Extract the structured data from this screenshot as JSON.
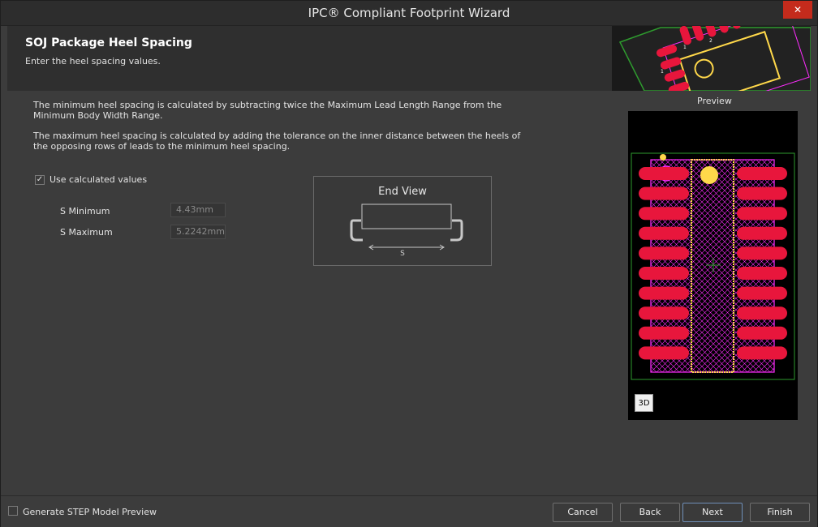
{
  "window": {
    "title": "IPC® Compliant Footprint Wizard",
    "close_label": "✕"
  },
  "header": {
    "title": "SOJ Package Heel Spacing",
    "subtitle": "Enter the heel spacing values.",
    "art_pad_labels": [
      "1",
      "2",
      "1"
    ]
  },
  "body": {
    "paragraph_1": "The minimum heel spacing is calculated by subtracting twice the Maximum Lead Length Range from the Minimum Body Width Range.",
    "paragraph_2": "The maximum heel spacing is calculated by adding the tolerance on the inner distance between the heels of the opposing rows of leads to the minimum heel spacing.",
    "use_calculated": {
      "label": "Use calculated values",
      "checked": true,
      "mark": "✓"
    },
    "s_minimum": {
      "label": "S Minimum",
      "value": "4.43mm"
    },
    "s_maximum": {
      "label": "S Maximum",
      "value": "5.2242mm"
    }
  },
  "end_view": {
    "title": "End View",
    "dimension_label": "S"
  },
  "preview": {
    "label": "Preview",
    "button_3d": "3D",
    "pad_rows": 10
  },
  "footer": {
    "generate_step": {
      "label": "Generate STEP Model Preview",
      "checked": false
    },
    "buttons": {
      "cancel": "Cancel",
      "back": "Back",
      "next": "Next",
      "finish": "Finish"
    }
  },
  "colors": {
    "pad": "#e8163c",
    "silkscreen": "#ff2cff",
    "courtyard": "#ffd84a",
    "board_outline": "#2e9a2e",
    "accent_button": "#6f8fb8"
  }
}
